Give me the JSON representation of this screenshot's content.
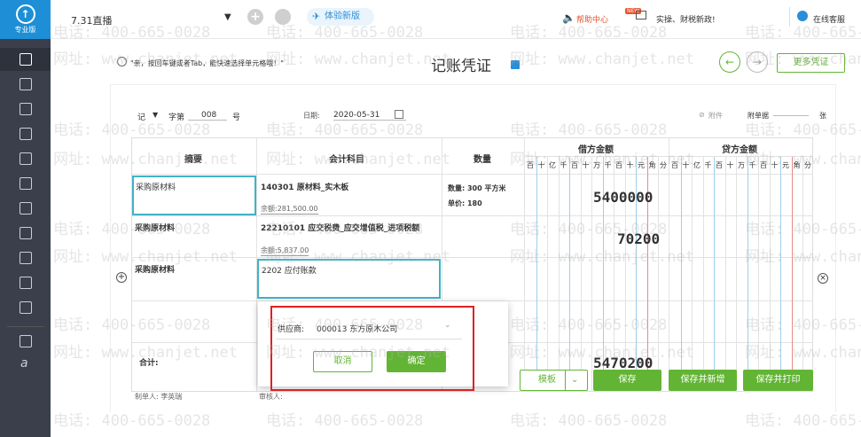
{
  "sidebar": {
    "brand": "专业版"
  },
  "topbar": {
    "account": "7.31直播",
    "experience": "体验新版",
    "help": "帮助中心",
    "news_badge": "NEW",
    "news": "实操、财税新政!",
    "service": "在线客服"
  },
  "hint": "\"亲，按回车键或者Tab，能快速选择单元格哦！\"",
  "page_title": "记账凭证",
  "more_voucher": "更多凭证",
  "voucher": {
    "type": "记",
    "zi_label": "字第",
    "number": "008",
    "hao": "号",
    "date_label": "日期:",
    "date": "2020-05-31",
    "attach_label": "附件",
    "attach_count_label": "附单据",
    "zhang": "张"
  },
  "table": {
    "headers": {
      "summary": "摘要",
      "account": "会计科目",
      "qty": "数量",
      "debit": "借方金额",
      "credit": "贷方金额"
    },
    "digit_units": [
      "百",
      "十",
      "亿",
      "千",
      "百",
      "十",
      "万",
      "千",
      "百",
      "十",
      "元",
      "角",
      "分"
    ],
    "rows": [
      {
        "summary": "采购原材料",
        "account": "140301 原材料_实木板",
        "balance": "余额:281,500.00",
        "qty": "数量: 300 平方米",
        "price": "单价: 180",
        "debit": "5400000"
      },
      {
        "summary": "采购原材料",
        "account": "22210101 应交税费_应交增值税_进项税额",
        "balance": "余额:5,837.00",
        "debit": "70200"
      },
      {
        "summary": "采购原材料",
        "account": "2202 应付账款"
      }
    ],
    "total_label": "合计:",
    "total_debit": "5470200"
  },
  "popup": {
    "supplier_label": "供应商:",
    "supplier_value": "000013 东方原木公司",
    "cancel": "取消",
    "confirm": "确定"
  },
  "footer": {
    "maker": "制单人: 李英瑞",
    "reviewer": "审核人:",
    "template": "模板",
    "save": "保存",
    "save_new": "保存并新增",
    "save_print": "保存并打印"
  },
  "watermark": {
    "phone": "电话: 400-665-0028",
    "site": "网址: www.chanjet.net"
  },
  "colors": {
    "accent": "#62b534",
    "brand": "#1e8fd6",
    "sidebar": "#3a3f4b",
    "highlight_border": "#e02020",
    "cell_focus": "#3fb3c8"
  }
}
